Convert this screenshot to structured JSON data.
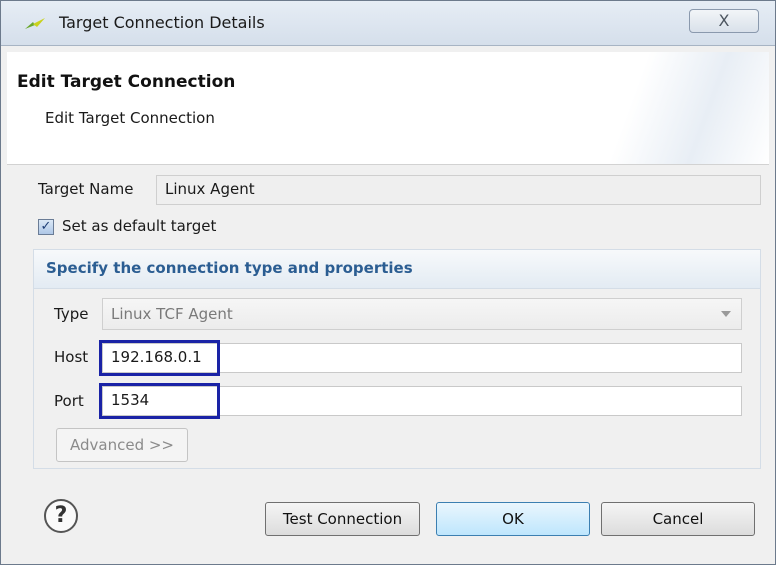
{
  "window": {
    "title": "Target Connection Details",
    "close_glyph": "X"
  },
  "banner": {
    "title": "Edit Target Connection",
    "subtitle": "Edit Target Connection"
  },
  "form": {
    "target_name_label": "Target Name",
    "target_name_value": "Linux Agent",
    "default_checkbox_label": "Set as default target",
    "default_checked": true,
    "group_title": "Specify the connection type and properties",
    "type_label": "Type",
    "type_value": "Linux TCF Agent",
    "host_label": "Host",
    "host_value": "192.168.0.1",
    "port_label": "Port",
    "port_value": "1534",
    "advanced_label": "Advanced >>"
  },
  "buttons": {
    "test_connection": "Test Connection",
    "ok": "OK",
    "cancel": "Cancel",
    "help": "?"
  },
  "colors": {
    "highlight": "#1a23a6",
    "group_title": "#2b5d92",
    "ok_border": "#3c7fb1"
  }
}
